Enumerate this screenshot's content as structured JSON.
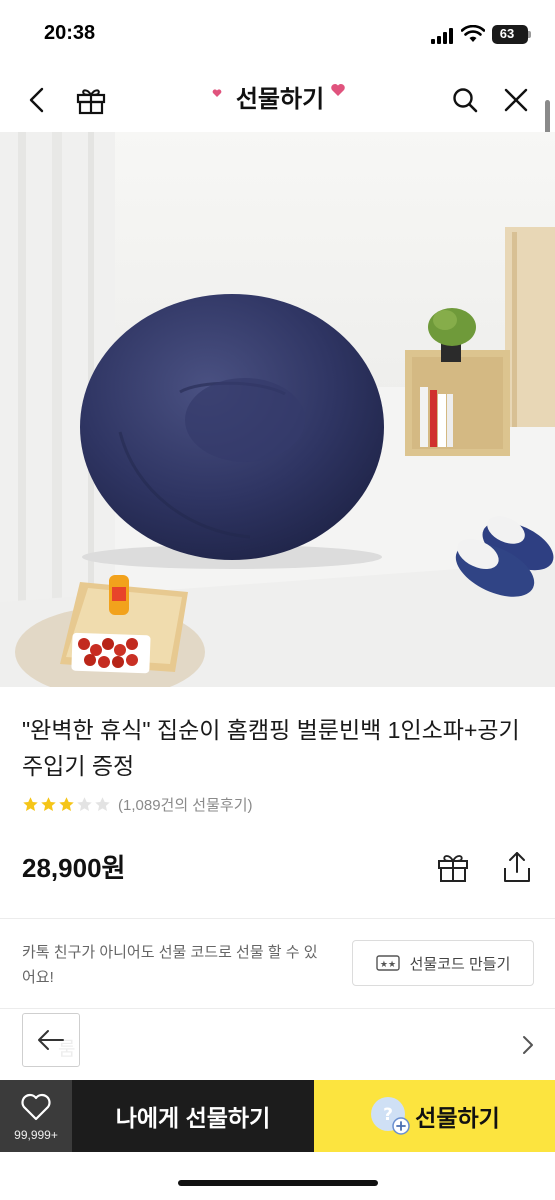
{
  "status_bar": {
    "time": "20:38",
    "battery": "63"
  },
  "nav": {
    "title": "선물하기",
    "icons": [
      "back-arrow-icon",
      "gift-box-icon",
      "search-icon",
      "close-icon"
    ]
  },
  "product": {
    "title": "\"완벽한 휴식\" 집순이 홈캠핑 벌룬빈백 1인소파+공기주입기 증정",
    "rating_stars": 3,
    "rating_max": 5,
    "review_count": "(1,089건의 선물후기)",
    "price": "28,900원"
  },
  "gift_code": {
    "description": "카톡 친구가 아니어도 선물 코드로 선물 할 수 있어요!",
    "button_label": "선물코드 만들기"
  },
  "hidden_row": {
    "label": "룸"
  },
  "bottom_bar": {
    "wish_count": "99,999+",
    "gift_self_label": "나에게 선물하기",
    "gift_friend_label": "선물하기"
  },
  "colors": {
    "accent_yellow": "#fce43f",
    "dark_button": "#1c1c1c",
    "wish_bg": "#3b3b3b",
    "star": "#f5c518",
    "heart_pink": "#e0537d"
  }
}
